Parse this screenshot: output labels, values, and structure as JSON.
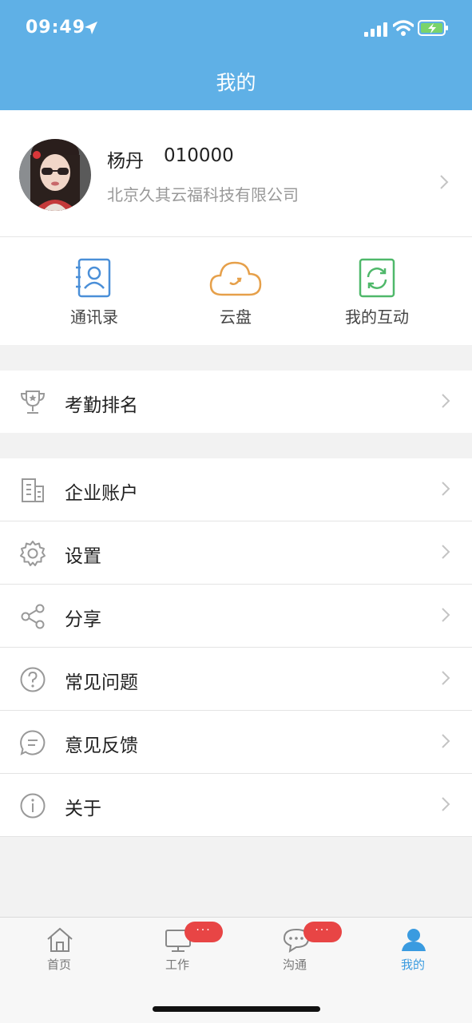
{
  "status_bar": {
    "time": "09:49"
  },
  "header": {
    "title": "我的"
  },
  "profile": {
    "name": "杨丹",
    "id": "010000",
    "company": "北京久其云福科技有限公司"
  },
  "quick_actions": [
    {
      "label": "通讯录",
      "icon": "contacts-icon",
      "color": "#4a8fd8"
    },
    {
      "label": "云盘",
      "icon": "cloud-icon",
      "color": "#e6a04a"
    },
    {
      "label": "我的互动",
      "icon": "refresh-icon",
      "color": "#4fb86a"
    }
  ],
  "menu": {
    "attendance": "考勤排名",
    "items": [
      {
        "label": "企业账户",
        "icon": "building-icon"
      },
      {
        "label": "设置",
        "icon": "gear-icon"
      },
      {
        "label": "分享",
        "icon": "share-icon"
      },
      {
        "label": "常见问题",
        "icon": "question-icon"
      },
      {
        "label": "意见反馈",
        "icon": "feedback-icon"
      },
      {
        "label": "关于",
        "icon": "info-icon"
      }
    ]
  },
  "tabbar": {
    "items": [
      {
        "label": "首页",
        "icon": "home-icon",
        "active": false
      },
      {
        "label": "工作",
        "icon": "monitor-icon",
        "active": false,
        "badge": "···"
      },
      {
        "label": "沟通",
        "icon": "chat-icon",
        "active": false,
        "badge": "···"
      },
      {
        "label": "我的",
        "icon": "user-icon",
        "active": true
      }
    ],
    "active_color": "#3a9be0"
  }
}
